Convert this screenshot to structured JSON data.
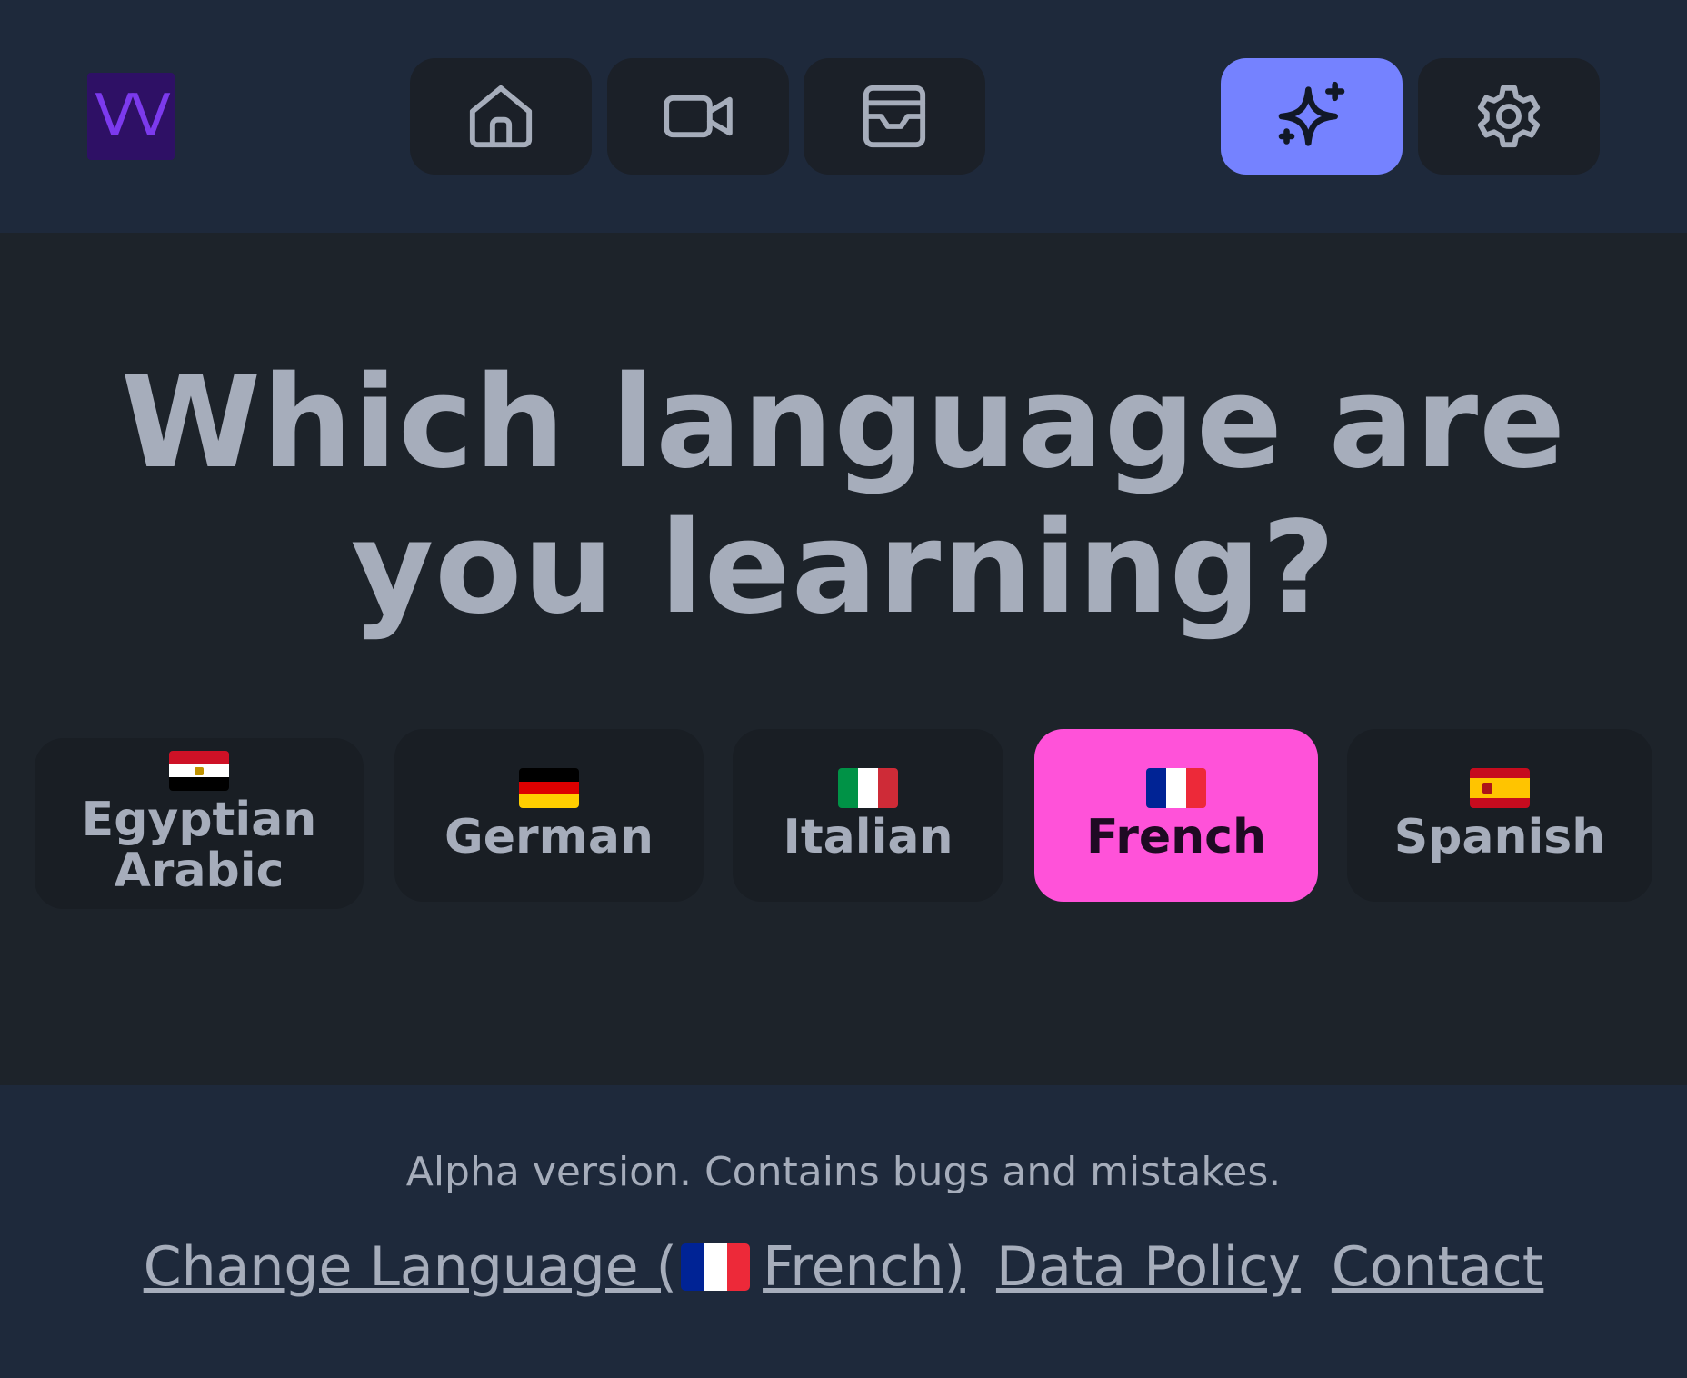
{
  "header": {
    "logo_text": "VV",
    "nav": [
      {
        "icon": "home-icon"
      },
      {
        "icon": "video-camera-icon"
      },
      {
        "icon": "inbox-icon"
      },
      {
        "icon": "sparkles-icon",
        "active": true
      },
      {
        "icon": "gear-icon"
      }
    ]
  },
  "main": {
    "title": "Which language are you learning?",
    "languages": [
      {
        "label": "Egyptian Arabic",
        "flag": "egypt-flag-icon",
        "selected": false
      },
      {
        "label": "German",
        "flag": "germany-flag-icon",
        "selected": false
      },
      {
        "label": "Italian",
        "flag": "italy-flag-icon",
        "selected": false
      },
      {
        "label": "French",
        "flag": "france-flag-icon",
        "selected": true
      },
      {
        "label": "Spanish",
        "flag": "spain-flag-icon",
        "selected": false
      }
    ]
  },
  "footer": {
    "notice": "Alpha version. Contains bugs and mistakes.",
    "links": {
      "change_language_prefix": "Change Language (",
      "change_language_suffix": " French)",
      "data_policy": "Data Policy",
      "contact": "Contact"
    }
  },
  "colors": {
    "header_bg": "#1e293b",
    "main_bg": "#1d232a",
    "button_bg": "#191e24",
    "active_nav": "#7582ff",
    "selected_language": "#ff52d9",
    "text": "#a6adbb",
    "logo_text": "#7c3aed",
    "logo_bg": "#2e1065"
  }
}
